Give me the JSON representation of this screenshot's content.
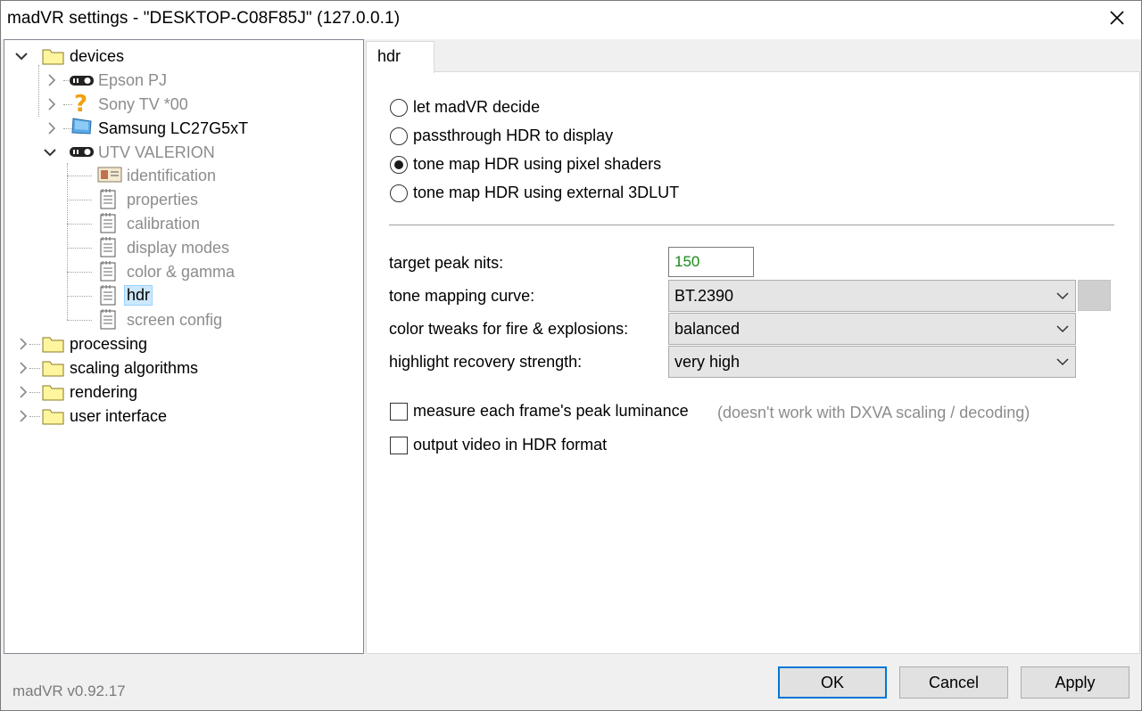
{
  "window": {
    "title": "madVR settings - \"DESKTOP-C08F85J\" (127.0.0.1)"
  },
  "tree": {
    "nodes": [
      {
        "label": "devices",
        "icon": "folder-icon",
        "state": "expanded"
      },
      {
        "label": "Epson PJ",
        "icon": "projector-icon",
        "state": "collapsed",
        "disabled": true
      },
      {
        "label": "Sony TV *00",
        "icon": "question-mark-icon",
        "state": "collapsed",
        "disabled": true
      },
      {
        "label": "Samsung LC27G5xT",
        "icon": "monitor-icon",
        "state": "collapsed"
      },
      {
        "label": "UTV VALERION",
        "icon": "projector-icon",
        "state": "expanded",
        "disabled": true
      },
      {
        "label": "identification",
        "icon": "id-card-icon",
        "disabled": true
      },
      {
        "label": "properties",
        "icon": "document-icon",
        "disabled": true
      },
      {
        "label": "calibration",
        "icon": "document-icon",
        "disabled": true
      },
      {
        "label": "display modes",
        "icon": "document-icon",
        "disabled": true
      },
      {
        "label": "color & gamma",
        "icon": "document-icon",
        "disabled": true
      },
      {
        "label": "hdr",
        "icon": "document-icon",
        "selected": true
      },
      {
        "label": "screen config",
        "icon": "document-icon",
        "disabled": true
      },
      {
        "label": "processing",
        "icon": "folder-icon",
        "state": "collapsed"
      },
      {
        "label": "scaling algorithms",
        "icon": "folder-icon",
        "state": "collapsed"
      },
      {
        "label": "rendering",
        "icon": "folder-icon",
        "state": "collapsed"
      },
      {
        "label": "user interface",
        "icon": "folder-icon",
        "state": "collapsed"
      }
    ]
  },
  "tab": {
    "label": "hdr"
  },
  "hdr_mode": {
    "options": [
      {
        "label": "let madVR decide",
        "checked": false
      },
      {
        "label": "passthrough HDR to display",
        "checked": false
      },
      {
        "label": "tone map HDR using pixel shaders",
        "checked": true
      },
      {
        "label": "tone map HDR using external 3DLUT",
        "checked": false
      }
    ]
  },
  "settings": {
    "target_peak_label": "target peak nits:",
    "target_peak_value": "150",
    "curve_label": "tone mapping curve:",
    "curve_value": "BT.2390",
    "tweaks_label": "color tweaks for fire & explosions:",
    "tweaks_value": "balanced",
    "recovery_label": "highlight recovery strength:",
    "recovery_value": "very high",
    "measure_label": "measure each frame's peak luminance",
    "measure_checked": false,
    "measure_note": "(doesn't work with DXVA scaling / decoding)",
    "output_label": "output video in HDR format",
    "output_checked": false
  },
  "footer": {
    "version": "madVR v0.92.17",
    "ok_label": "OK",
    "cancel_label": "Cancel",
    "apply_label": "Apply"
  },
  "colors": {
    "value_text": "#168a16",
    "selection": "#cce8ff",
    "default_button_border": "#0078d7"
  }
}
